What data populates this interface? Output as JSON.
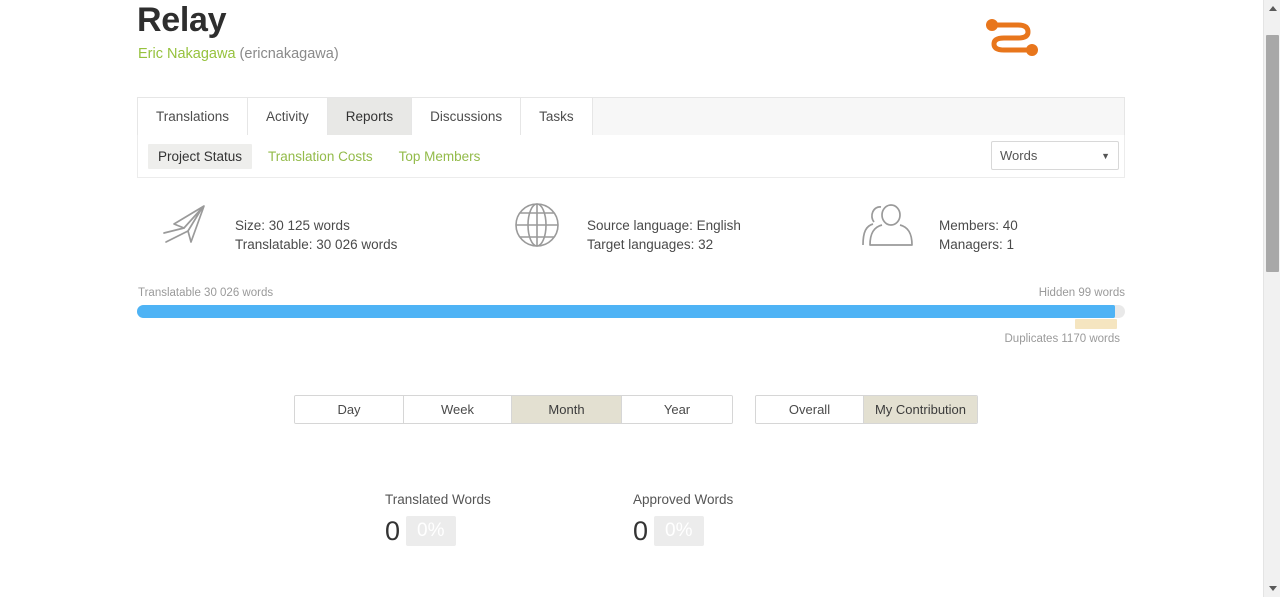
{
  "header": {
    "project_title": "Relay",
    "owner_name": "Eric Nakagawa",
    "owner_handle": "(ericnakagawa)",
    "logo_name": "relay-logo",
    "logo_color": "#e8761c"
  },
  "tabs": [
    {
      "label": "Translations",
      "active": false
    },
    {
      "label": "Activity",
      "active": false
    },
    {
      "label": "Reports",
      "active": true
    },
    {
      "label": "Discussions",
      "active": false
    },
    {
      "label": "Tasks",
      "active": false
    }
  ],
  "subtabs": [
    {
      "label": "Project Status",
      "active": true
    },
    {
      "label": "Translation Costs",
      "active": false
    },
    {
      "label": "Top Members",
      "active": false
    }
  ],
  "unit_select": {
    "value": "Words",
    "caret": "▼"
  },
  "summary": [
    {
      "icon": "paper-plane-icon",
      "line1": "Size: 30 125 words",
      "line2": "Translatable: 30 026 words"
    },
    {
      "icon": "globe-icon",
      "line1": "Source language: English",
      "line2": "Target languages: 32"
    },
    {
      "icon": "members-icon",
      "line1": "Members: 40",
      "line2": "Managers: 1"
    }
  ],
  "progress": {
    "left_label": "Translatable 30 026 words",
    "right_label": "Hidden 99 words",
    "duplicates_label": "Duplicates 1170 words",
    "fill_percent": 99,
    "fill_color": "#4eb3f5",
    "track_color": "#e9e9e9",
    "duplicates_color": "#f5e5c0"
  },
  "period_buttons": [
    {
      "label": "Day",
      "active": false
    },
    {
      "label": "Week",
      "active": false
    },
    {
      "label": "Month",
      "active": true
    },
    {
      "label": "Year",
      "active": false
    }
  ],
  "scope_buttons": [
    {
      "label": "Overall",
      "active": false
    },
    {
      "label": "My Contribution",
      "active": true
    }
  ],
  "stats": [
    {
      "title": "Translated Words",
      "value": "0",
      "percent": "0%"
    },
    {
      "title": "Approved Words",
      "value": "0",
      "percent": "0%"
    }
  ],
  "scrollbar": {
    "up_arrow": "scroll-up-arrow",
    "down_arrow": "scroll-down-arrow"
  }
}
